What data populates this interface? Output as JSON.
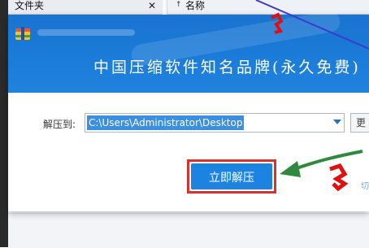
{
  "explorer": {
    "tab_label": "文件夹",
    "tab_close": "✕",
    "column_name_arrow": "↑",
    "column_name_label": "名称"
  },
  "dialog": {
    "slogan": "中国压缩软件知名品牌(永久免费)",
    "extract_to_label": "解压到:",
    "path_value": "C:\\Users\\Administrator\\Desktop",
    "browse_label": "更",
    "extract_now_label": "立即解压",
    "side_link_label": "切",
    "accent_color": "#1b7cda"
  },
  "annotations": {
    "highlight_color": "#d8322c",
    "arrow_color": "#2d8a3e",
    "mark_color": "#e01010"
  }
}
